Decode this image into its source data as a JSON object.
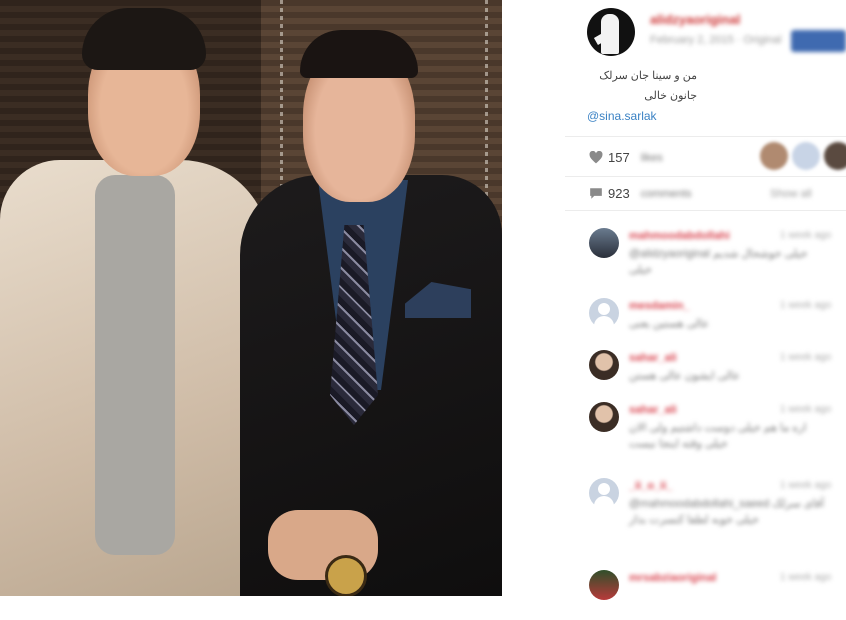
{
  "post": {
    "username": "alidzyaoriginal",
    "date": "February 2, 2015 · Original",
    "caption_lines": [
      "من و سینا جان سرلک",
      "جانون خالی"
    ],
    "mention": "@sina.sarlak",
    "likes_count": "157",
    "likes_suffix": "likes",
    "comments_count": "923",
    "comments_suffix": "comments",
    "show_all": "Show all"
  },
  "comments": [
    {
      "name": "mahmoodabdollahi",
      "time": "1 week ago",
      "text": "@alidzyaoriginal خیلی خوشحال شدیم خیلی"
    },
    {
      "name": "mesdamin_",
      "time": "1 week ago",
      "text": "عالی هستین یعنی"
    },
    {
      "name": "sahar_ali",
      "time": "1 week ago",
      "text": "عالی ایشون عالی هستن"
    },
    {
      "name": "sahar_ali",
      "time": "1 week ago",
      "text": "اره ما هم خیلی دوست داشتیم ولی الان خیلی وقته اینجا نیست"
    },
    {
      "name": "_ii_o_ii_",
      "time": "1 week ago",
      "text": "@mahmoodabdollahi_saeed آقای سرلک خیلی خوبه لطفا کنسرت بذار"
    },
    {
      "name": "mrsabziaoriginal",
      "time": "1 week ago",
      "text": ""
    }
  ]
}
